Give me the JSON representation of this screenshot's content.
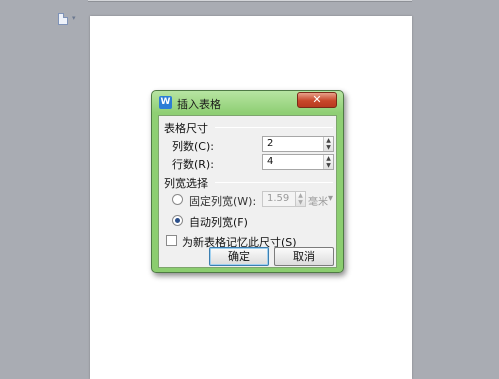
{
  "dialog": {
    "title": "插入表格",
    "app_icon": "W",
    "close_symbol": "✕",
    "table_size": {
      "section_label": "表格尺寸",
      "columns_label": "列数(C):",
      "columns_value": "2",
      "rows_label": "行数(R):",
      "rows_value": "4"
    },
    "column_width": {
      "section_label": "列宽选择",
      "fixed_label": "固定列宽(W):",
      "fixed_value": "1.59",
      "fixed_unit": "毫米",
      "auto_label": "自动列宽(F)",
      "selected": "auto"
    },
    "remember_label": "为新表格记忆此尺寸(S)",
    "remember_checked": false,
    "ok_label": "确定",
    "cancel_label": "取消"
  },
  "icons": {
    "spin_up": "▲",
    "spin_down": "▼",
    "dropdown": "▾"
  },
  "colors": {
    "frame_green": "#8bcd6f",
    "close_red": "#c8472a",
    "default_button_border": "#3c7fb1"
  }
}
